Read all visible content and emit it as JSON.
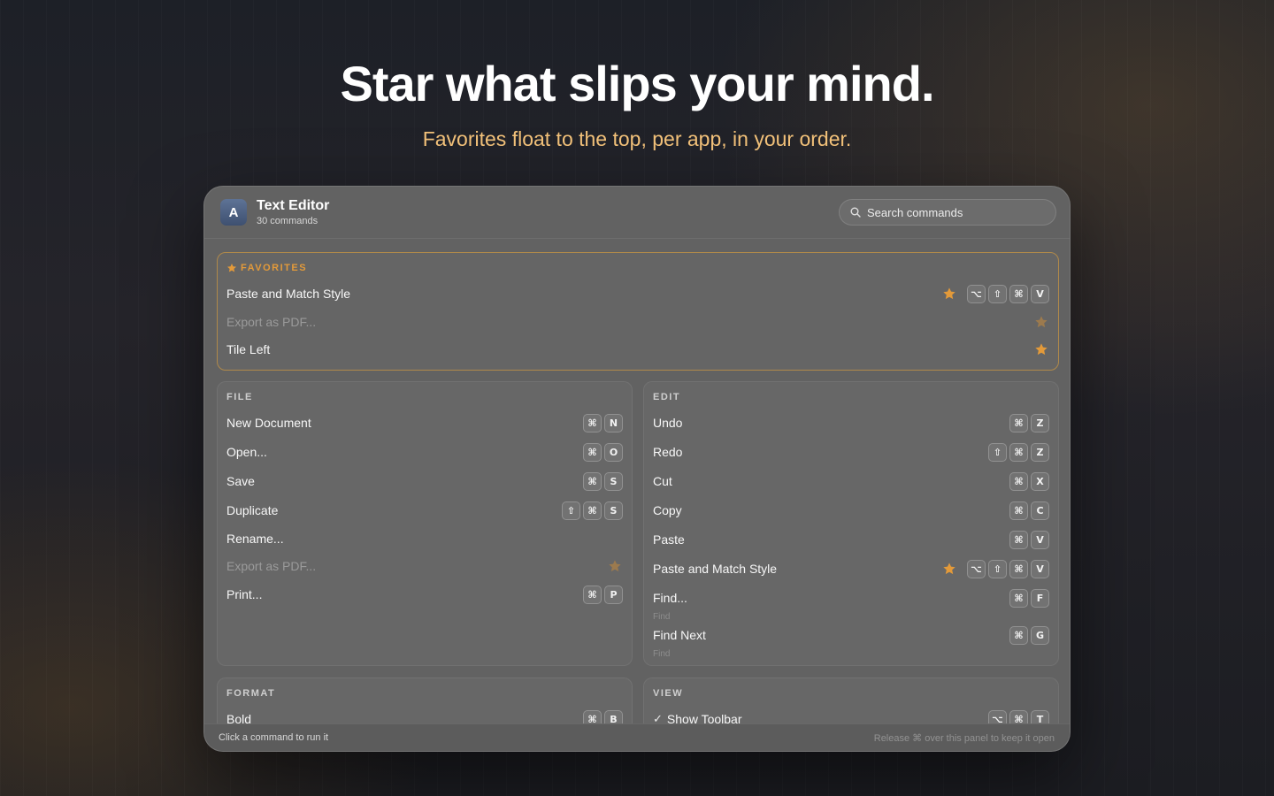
{
  "hero": {
    "title": "Star what slips your mind.",
    "subtitle": "Favorites float to the top, per app, in your order."
  },
  "app": {
    "icon_letter": "A",
    "name": "Text Editor",
    "command_count": "30 commands"
  },
  "search": {
    "placeholder": "Search commands"
  },
  "colors": {
    "accent": "#e39a3a",
    "panel": "#626262",
    "subtitle": "#f3c27a"
  },
  "favorites": {
    "label": "FAVORITES",
    "items": [
      {
        "label": "Paste and Match Style",
        "keys": [
          "⌥",
          "⇧",
          "⌘",
          "V"
        ],
        "starred": true,
        "disabled": false
      },
      {
        "label": "Export as PDF...",
        "keys": [],
        "starred": true,
        "disabled": true
      },
      {
        "label": "Tile Left",
        "keys": [],
        "starred": true,
        "disabled": false
      }
    ]
  },
  "file": {
    "label": "FILE",
    "items": [
      {
        "label": "New Document",
        "keys": [
          "⌘",
          "N"
        ]
      },
      {
        "label": "Open...",
        "keys": [
          "⌘",
          "O"
        ]
      },
      {
        "label": "Save",
        "keys": [
          "⌘",
          "S"
        ]
      },
      {
        "label": "Duplicate",
        "keys": [
          "⇧",
          "⌘",
          "S"
        ]
      },
      {
        "label": "Rename...",
        "keys": []
      },
      {
        "label": "Export as PDF...",
        "keys": [],
        "starred": true,
        "disabled": true
      },
      {
        "label": "Print...",
        "keys": [
          "⌘",
          "P"
        ]
      }
    ]
  },
  "edit": {
    "label": "EDIT",
    "items": [
      {
        "label": "Undo",
        "keys": [
          "⌘",
          "Z"
        ]
      },
      {
        "label": "Redo",
        "keys": [
          "⇧",
          "⌘",
          "Z"
        ]
      },
      {
        "label": "Cut",
        "keys": [
          "⌘",
          "X"
        ]
      },
      {
        "label": "Copy",
        "keys": [
          "⌘",
          "C"
        ]
      },
      {
        "label": "Paste",
        "keys": [
          "⌘",
          "V"
        ]
      },
      {
        "label": "Paste and Match Style",
        "keys": [
          "⌥",
          "⇧",
          "⌘",
          "V"
        ],
        "starred": true
      },
      {
        "label": "Find...",
        "sub": "Find",
        "keys": [
          "⌘",
          "F"
        ]
      },
      {
        "label": "Find Next",
        "sub": "Find",
        "keys": [
          "⌘",
          "G"
        ]
      }
    ]
  },
  "format": {
    "label": "FORMAT",
    "items": [
      {
        "label": "Bold",
        "keys": [
          "⌘",
          "B"
        ]
      }
    ]
  },
  "view": {
    "label": "VIEW",
    "items": [
      {
        "label": "Show Toolbar",
        "checked": true,
        "keys": [
          "⌥",
          "⌘",
          "T"
        ]
      }
    ]
  },
  "footer": {
    "left": "Click a command to run it",
    "right": "Release ⌘ over this panel to keep it open"
  }
}
